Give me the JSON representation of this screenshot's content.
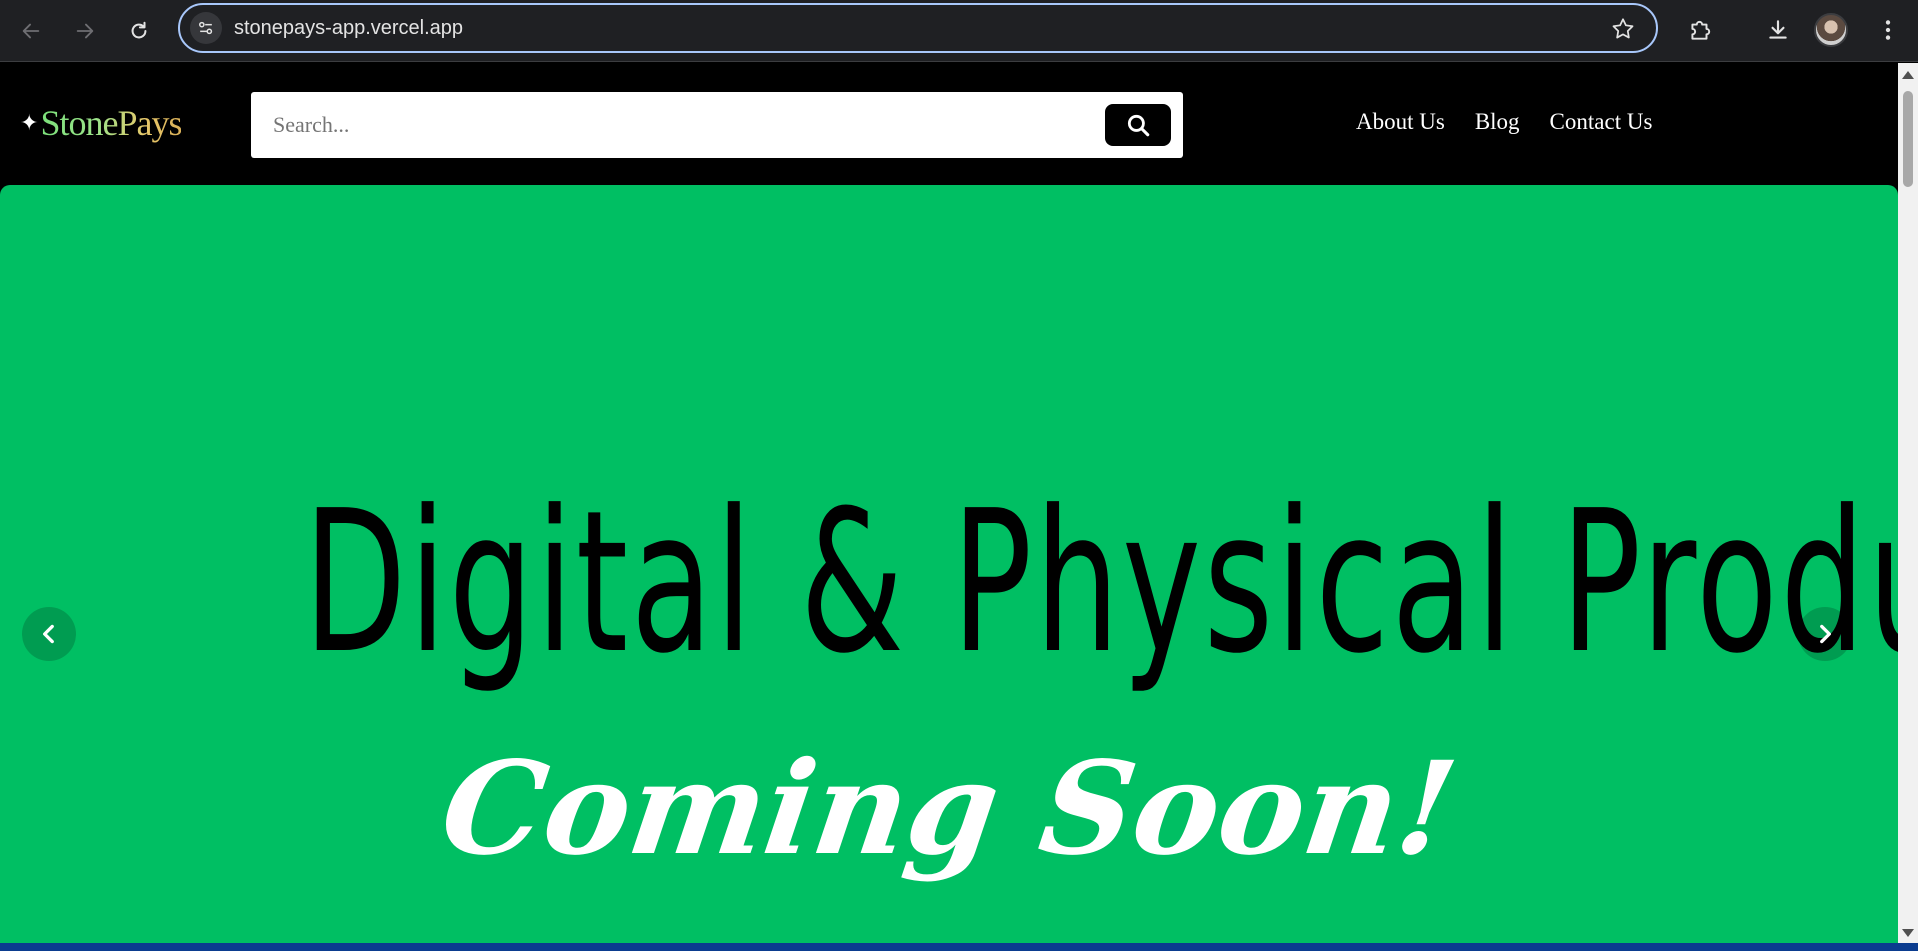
{
  "browser": {
    "url": "stonepays-app.vercel.app",
    "icons": {
      "back": "back-arrow-icon",
      "forward": "forward-arrow-icon",
      "reload": "reload-icon",
      "site_info": "tune-icon",
      "bookmark": "star-icon",
      "extensions": "puzzle-icon",
      "downloads": "download-icon",
      "menu": "kebab-menu-icon"
    }
  },
  "site": {
    "logo": {
      "spark": "✦",
      "text": "StonePays"
    },
    "search": {
      "placeholder": "Search...",
      "value": ""
    },
    "nav": {
      "about": "About Us",
      "blog": "Blog",
      "contact": "Contact Us"
    },
    "hero": {
      "headline": "Digital & Physical Products",
      "subheadline": "Coming Soon!",
      "background_color": "#00bf63"
    }
  },
  "colors": {
    "header_bg": "#000000",
    "hero_green": "#00bf63",
    "browser_bg": "#1f2023",
    "omnibox_border": "#a8c7fa"
  }
}
